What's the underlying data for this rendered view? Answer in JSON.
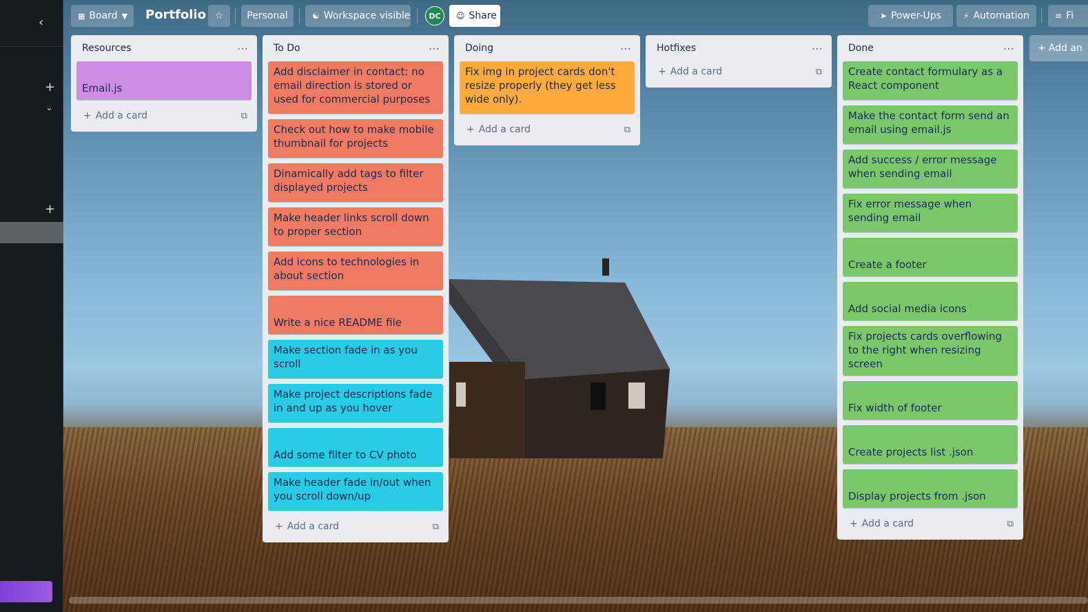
{
  "sidebar": {
    "collapse_icon": "chevron-left-icon",
    "add_icon": "plus-icon",
    "expand_icon": "chevron-down-icon",
    "add_icon_2": "plus-icon"
  },
  "topbar": {
    "view_label": "Board",
    "board_title": "Portfolio",
    "visibility_personal": "Personal",
    "visibility_workspace": "Workspace visible",
    "avatar_initials": "DC",
    "share_label": "Share",
    "powerups_label": "Power-Ups",
    "automation_label": "Automation",
    "filter_label": "Fi"
  },
  "lists": [
    {
      "title": "Resources",
      "cards": [
        {
          "text": "Email.js",
          "color": "purple"
        }
      ],
      "add_label": "Add a card"
    },
    {
      "title": "To Do",
      "cards": [
        {
          "text": "Add disclaimer in contact: no email direction is stored or used for commercial purposes",
          "color": "red"
        },
        {
          "text": "Check out how to make mobile thumbnail for projects",
          "color": "red"
        },
        {
          "text": "Dinamically add tags to filter displayed projects",
          "color": "red"
        },
        {
          "text": "Make header links scroll down to proper section",
          "color": "red"
        },
        {
          "text": "Add icons to technologies in about section",
          "color": "red"
        },
        {
          "text": "Write a nice README file",
          "color": "red"
        },
        {
          "text": "Make section fade in as you scroll",
          "color": "cyan"
        },
        {
          "text": "Make project descriptions fade in and up as you hover",
          "color": "cyan"
        },
        {
          "text": "Add some filter to CV photo",
          "color": "cyan"
        },
        {
          "text": "Make header fade in/out when you scroll down/up",
          "color": "cyan"
        }
      ],
      "add_label": "Add a card"
    },
    {
      "title": "Doing",
      "cards": [
        {
          "text": "Fix img in project cards don't resize properly (they get less wide only).",
          "color": "orange"
        }
      ],
      "add_label": "Add a card"
    },
    {
      "title": "Hotfixes",
      "cards": [],
      "add_label": "Add a card"
    },
    {
      "title": "Done",
      "cards": [
        {
          "text": "Create contact formulary as a React component",
          "color": "green"
        },
        {
          "text": "Make the contact form send an email using email.js",
          "color": "green"
        },
        {
          "text": "Add success / error message when sending email",
          "color": "green"
        },
        {
          "text": "Fix error message when sending email",
          "color": "green"
        },
        {
          "text": "Create a footer",
          "color": "green"
        },
        {
          "text": "Add social media icons",
          "color": "green"
        },
        {
          "text": "Fix projects cards overflowing to the right when resizing screen",
          "color": "green"
        },
        {
          "text": "Fix width of footer",
          "color": "green"
        },
        {
          "text": "Create projects list .json",
          "color": "green"
        },
        {
          "text": "Display projects from .json",
          "color": "green"
        }
      ],
      "add_label": "Add a card"
    }
  ],
  "add_list_label": "Add an",
  "colors": {
    "red": "#f07a62",
    "cyan": "#29cce5",
    "orange": "#ffab3b",
    "green": "#7bc86c",
    "purple": "#cd8de5",
    "list_bg": "#ebecf0",
    "sidebar_bg": "#161a1d"
  }
}
